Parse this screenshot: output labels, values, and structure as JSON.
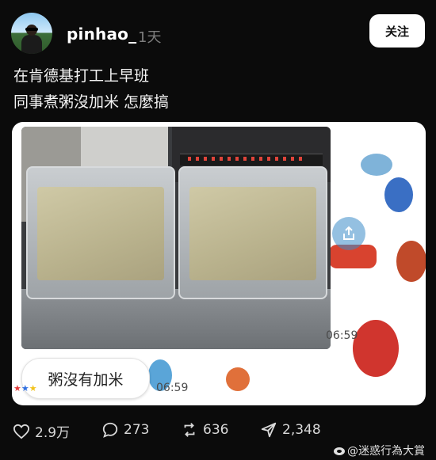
{
  "post": {
    "username": "pinhao_",
    "time_ago": "1天",
    "follow_label": "关注",
    "caption_lines": [
      "在肯德基打工上早班",
      "同事煮粥沒加米 怎麼搞"
    ]
  },
  "media": {
    "video_time_1": "06:59",
    "video_time_2": "06:59",
    "bubble_text": "粥沒有加米",
    "share_icon": "share-icon"
  },
  "actions": {
    "likes": "2.9万",
    "comments": "273",
    "reposts": "636",
    "shares": "2,348"
  },
  "watermark": "@迷惑行為大賞",
  "colors": {
    "background": "#0b0b0b",
    "text": "#f2f2f2",
    "muted": "#7d7d7d",
    "follow_bg": "#ffffff"
  }
}
